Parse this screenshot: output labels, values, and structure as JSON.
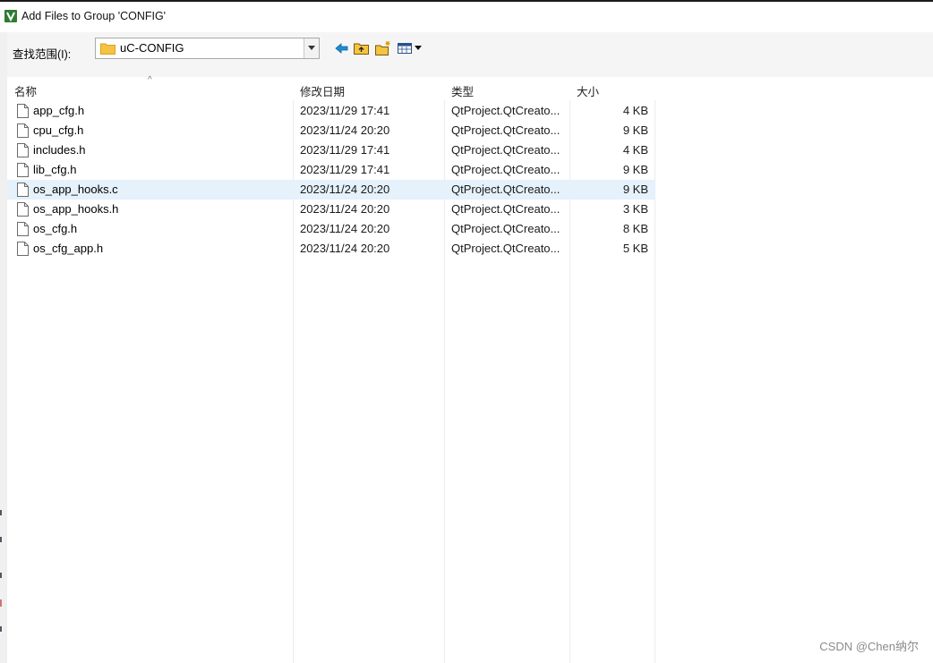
{
  "window": {
    "title": "Add Files to Group 'CONFIG'"
  },
  "lookin": {
    "label": "查找范围(I):",
    "value": "uC-CONFIG"
  },
  "toolbar": {
    "icons": [
      "back-icon",
      "up-folder-icon",
      "new-folder-icon",
      "view-menu-icon"
    ]
  },
  "columns": {
    "name": "名称",
    "date": "修改日期",
    "type": "类型",
    "size": "大小"
  },
  "files": [
    {
      "name": "app_cfg.h",
      "date": "2023/11/29 17:41",
      "type": "QtProject.QtCreato...",
      "size": "4 KB"
    },
    {
      "name": "cpu_cfg.h",
      "date": "2023/11/24 20:20",
      "type": "QtProject.QtCreato...",
      "size": "9 KB"
    },
    {
      "name": "includes.h",
      "date": "2023/11/29 17:41",
      "type": "QtProject.QtCreato...",
      "size": "4 KB"
    },
    {
      "name": "lib_cfg.h",
      "date": "2023/11/29 17:41",
      "type": "QtProject.QtCreato...",
      "size": "9 KB"
    },
    {
      "name": "os_app_hooks.c",
      "date": "2023/11/24 20:20",
      "type": "QtProject.QtCreato...",
      "size": "9 KB",
      "selected": true
    },
    {
      "name": "os_app_hooks.h",
      "date": "2023/11/24 20:20",
      "type": "QtProject.QtCreato...",
      "size": "3 KB"
    },
    {
      "name": "os_cfg.h",
      "date": "2023/11/24 20:20",
      "type": "QtProject.QtCreato...",
      "size": "8 KB"
    },
    {
      "name": "os_cfg_app.h",
      "date": "2023/11/24 20:20",
      "type": "QtProject.QtCreato...",
      "size": "5 KB"
    }
  ],
  "watermark": "CSDN @Chen纳尔",
  "colors": {
    "selected_row": "#e5f1fb",
    "folder": "#f5c342",
    "app_icon": "#2e7d32",
    "back_arrow": "#1a8fd6"
  }
}
